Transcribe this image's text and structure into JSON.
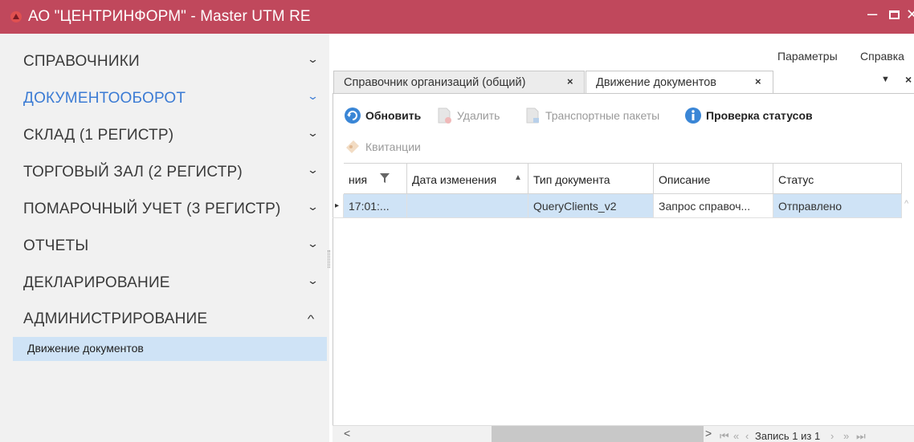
{
  "window": {
    "title": "АО \"ЦЕНТРИНФОРМ\" - Master UTM RE",
    "minimize_glyph": "–",
    "close_glyph": "✕"
  },
  "sidebar": {
    "items": [
      {
        "label": "СПРАВОЧНИКИ",
        "chevron": "⌄",
        "active": false
      },
      {
        "label": "ДОКУМЕНТООБОРОТ",
        "chevron": "⌄",
        "active": true
      },
      {
        "label": "СКЛАД (1 РЕГИСТР)",
        "chevron": "⌄",
        "active": false
      },
      {
        "label": "ТОРГОВЫЙ ЗАЛ (2 РЕГИСТР)",
        "chevron": "⌄",
        "active": false
      },
      {
        "label": "ПОМАРОЧНЫЙ УЧЕТ (3 РЕГИСТР)",
        "chevron": "⌄",
        "active": false
      },
      {
        "label": "ОТЧЕТЫ",
        "chevron": "⌄",
        "active": false
      },
      {
        "label": "ДЕКЛАРИРОВАНИЕ",
        "chevron": "⌄",
        "active": false
      },
      {
        "label": "АДМИНИСТРИРОВАНИЕ",
        "chevron": "^",
        "active": false
      }
    ],
    "sub_item": "Движение документов"
  },
  "top_menu": {
    "params": "Параметры",
    "help": "Справка"
  },
  "tabs": [
    {
      "label": "Справочник организаций (общий)",
      "close": "×"
    },
    {
      "label": "Движение документов",
      "close": "×"
    }
  ],
  "tab_controls": {
    "dropdown": "▼",
    "close": "×"
  },
  "toolbar": {
    "refresh": "Обновить",
    "delete": "Удалить",
    "transport": "Транспортные пакеты",
    "check_status": "Проверка статусов",
    "receipts": "Квитанции"
  },
  "grid": {
    "columns": [
      "ния",
      "Дата изменения",
      "Тип документа",
      "Описание",
      "Статус"
    ],
    "sort_glyph": "▲",
    "rows": [
      {
        "marker": "▸",
        "time": "17:01:...",
        "changed": "",
        "type": "QueryClients_v2",
        "description": "Запрос справоч...",
        "status": "Отправлено"
      }
    ]
  },
  "scroll": {
    "left": "<",
    "right": ">",
    "up": "^",
    "down": "⌄"
  },
  "pager": {
    "first": "⏮",
    "prev_page": "«",
    "prev": "‹",
    "text": "Запись 1 из 1",
    "next": "›",
    "next_page": "»",
    "last": "⏭"
  },
  "colors": {
    "titlebar": "#c0485c",
    "active_nav": "#3b7bd4",
    "selection": "#cfe3f6",
    "sidebar_bg": "#f1f1f1"
  }
}
